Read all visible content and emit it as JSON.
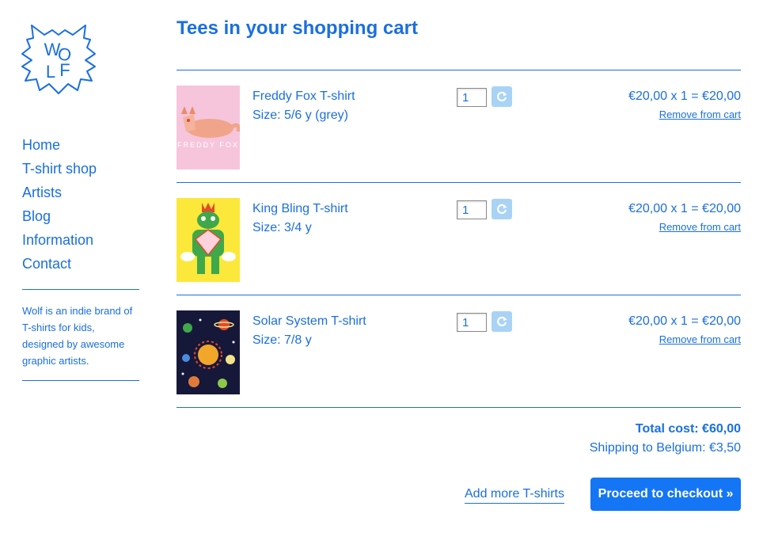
{
  "colors": {
    "accent": "#1a6fe0",
    "button_bg": "#1476f5",
    "refresh_bg": "#a8d3f5"
  },
  "logo": {
    "letters": [
      "W",
      "O",
      "L",
      "F"
    ]
  },
  "nav": {
    "items": [
      {
        "label": "Home"
      },
      {
        "label": "T-shirt shop"
      },
      {
        "label": "Artists"
      },
      {
        "label": "Blog"
      },
      {
        "label": "Information"
      },
      {
        "label": "Contact"
      }
    ]
  },
  "sidebar": {
    "blurb": "Wolf is an indie brand of T-shirts for kids, designed by awesome graphic artists."
  },
  "cart": {
    "title": "Tees in your shopping cart",
    "items": [
      {
        "name": "Freddy Fox T-shirt",
        "size": "Size: 5/6 y (grey)",
        "qty": "1",
        "price": "€20,00 x 1 = €20,00",
        "remove": "Remove from cart",
        "image_text": "FREDDY FOX"
      },
      {
        "name": "King Bling T-shirt",
        "size": "Size: 3/4 y",
        "qty": "1",
        "price": "€20,00 x 1 = €20,00",
        "remove": "Remove from cart"
      },
      {
        "name": "Solar System T-shirt",
        "size": "Size: 7/8 y",
        "qty": "1",
        "price": "€20,00 x 1 = €20,00",
        "remove": "Remove from cart"
      }
    ],
    "total": "Total cost: €60,00",
    "shipping": "Shipping to Belgium: €3,50",
    "add_more": "Add more T-shirts",
    "checkout": "Proceed to checkout »"
  }
}
